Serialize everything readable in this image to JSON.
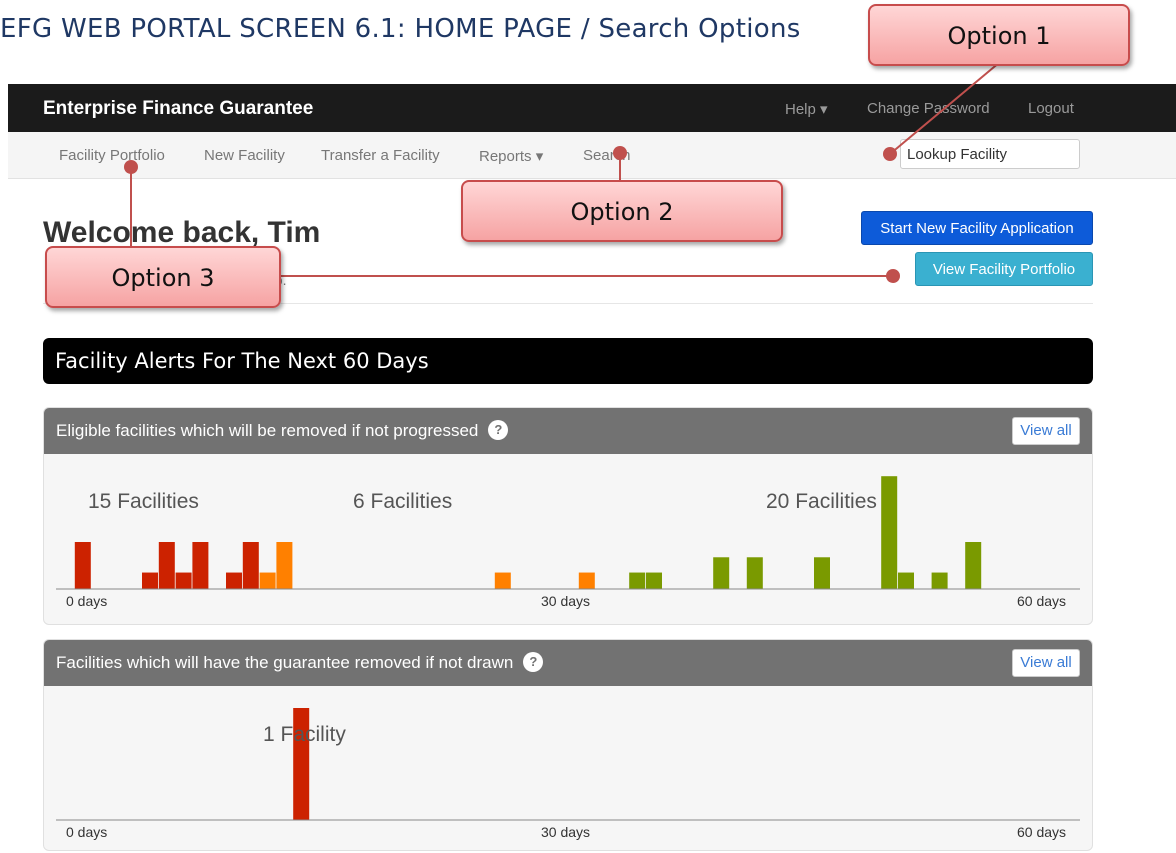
{
  "doc_title": "EFG WEB PORTAL SCREEN 6.1: HOME PAGE / Search Options",
  "header": {
    "brand": "Enterprise Finance Guarantee",
    "help": "Help ▾",
    "change_password": "Change Password",
    "logout": "Logout"
  },
  "subnav": {
    "items": [
      {
        "label": "Facility Portfolio"
      },
      {
        "label": "New Facility"
      },
      {
        "label": "Transfer a Facility"
      },
      {
        "label": "Reports ▾"
      },
      {
        "label": "Search"
      }
    ],
    "lookup_value": "Lookup Facility"
  },
  "main": {
    "welcome": "Welcome back, Tim",
    "subtext": "go.",
    "start_button": "Start New Facility Application",
    "portfolio_button": "View Facility Portfolio",
    "alerts_title": "Facility Alerts For The Next 60 Days"
  },
  "panels": [
    {
      "title": "Eligible facilities which will be removed if not progressed",
      "help_icon": "?",
      "view_all": "View all",
      "group_labels": [
        "15 Facilities",
        "6 Facilities",
        "20 Facilities"
      ],
      "axis_labels": [
        "0 days",
        "30 days",
        "60 days"
      ]
    },
    {
      "title": "Facilities which will have the guarantee removed if not drawn",
      "help_icon": "?",
      "view_all": "View all",
      "group_labels": [
        "1 Facility"
      ],
      "axis_labels": [
        "0 days",
        "30 days",
        "60 days"
      ]
    }
  ],
  "callouts": {
    "option1": "Option 1",
    "option2": "Option 2",
    "option3": "Option 3"
  },
  "colors": {
    "red": "#cc2200",
    "orange": "#ff8000",
    "green": "#7a9a00",
    "callout_line": "#c0504d"
  },
  "chart_data": [
    {
      "type": "bar",
      "xlabel": "",
      "ylabel": "",
      "x_ticks": [
        "0 days",
        "30 days",
        "60 days"
      ],
      "xlim": [
        0,
        60
      ],
      "ylim": [
        0,
        4
      ],
      "bars": [
        {
          "day": 1,
          "value": 2,
          "color": "red"
        },
        {
          "day": 5,
          "value": 0.7,
          "color": "red"
        },
        {
          "day": 6,
          "value": 2,
          "color": "red"
        },
        {
          "day": 7,
          "value": 0.7,
          "color": "red"
        },
        {
          "day": 8,
          "value": 2,
          "color": "red"
        },
        {
          "day": 10,
          "value": 0.7,
          "color": "red"
        },
        {
          "day": 11,
          "value": 2,
          "color": "red"
        },
        {
          "day": 12,
          "value": 0.7,
          "color": "orange"
        },
        {
          "day": 13,
          "value": 2,
          "color": "orange"
        },
        {
          "day": 26,
          "value": 0.7,
          "color": "orange"
        },
        {
          "day": 31,
          "value": 0.7,
          "color": "orange"
        },
        {
          "day": 34,
          "value": 0.7,
          "color": "green"
        },
        {
          "day": 35,
          "value": 0.7,
          "color": "green"
        },
        {
          "day": 39,
          "value": 1.35,
          "color": "green"
        },
        {
          "day": 41,
          "value": 1.35,
          "color": "green"
        },
        {
          "day": 45,
          "value": 1.35,
          "color": "green"
        },
        {
          "day": 49,
          "value": 4.8,
          "color": "green"
        },
        {
          "day": 50,
          "value": 0.7,
          "color": "green"
        },
        {
          "day": 52,
          "value": 0.7,
          "color": "green"
        },
        {
          "day": 54,
          "value": 2,
          "color": "green"
        }
      ]
    },
    {
      "type": "bar",
      "xlabel": "",
      "ylabel": "",
      "x_ticks": [
        "0 days",
        "30 days",
        "60 days"
      ],
      "xlim": [
        0,
        60
      ],
      "ylim": [
        0,
        1
      ],
      "bars": [
        {
          "day": 14,
          "value": 1,
          "color": "red"
        }
      ]
    }
  ]
}
